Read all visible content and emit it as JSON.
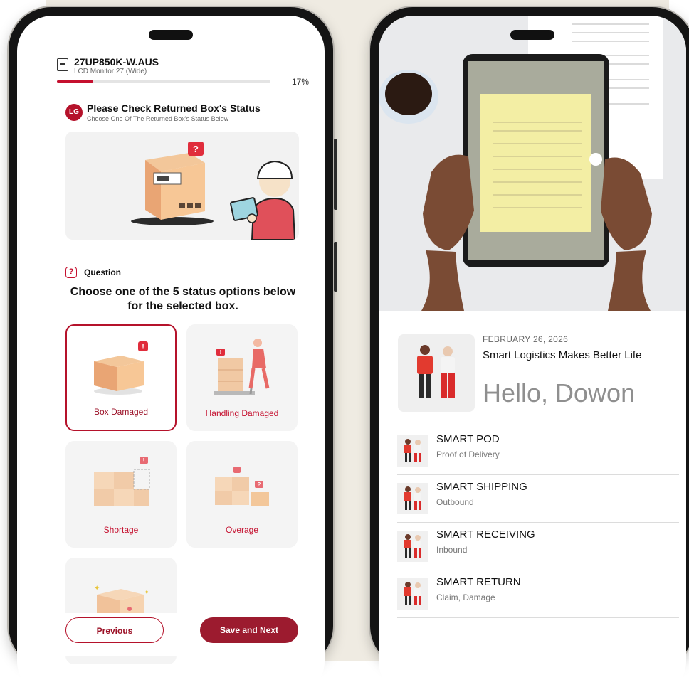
{
  "left_phone": {
    "product": {
      "model": "27UP850K-W.AUS",
      "description": "LCD Monitor 27 (Wide)"
    },
    "progress": {
      "percent": 17,
      "label": "17%"
    },
    "brand_logo": "LG",
    "section": {
      "title": "Please Check Returned Box's Status",
      "subtitle": "Choose One Of The Returned Box's Status Below"
    },
    "question": {
      "icon_label": "?",
      "label": "Question",
      "text": "Choose one of the 5 status options below for the selected box."
    },
    "options": [
      {
        "label": "Box Damaged",
        "selected": true
      },
      {
        "label": "Handling Damaged",
        "selected": false
      },
      {
        "label": "Shortage",
        "selected": false
      },
      {
        "label": "Overage",
        "selected": false
      },
      {
        "label": "",
        "selected": false
      }
    ],
    "buttons": {
      "previous": "Previous",
      "next": "Save and Next"
    }
  },
  "right_phone": {
    "date": "FEBRUARY 26, 2026",
    "tagline": "Smart Logistics Makes Better Life",
    "greeting": "Hello, Dowon",
    "menu": [
      {
        "title": "SMART POD",
        "subtitle": "Proof of Delivery"
      },
      {
        "title": "SMART SHIPPING",
        "subtitle": "Outbound"
      },
      {
        "title": "SMART RECEIVING",
        "subtitle": "Inbound"
      },
      {
        "title": "SMART RETURN",
        "subtitle": "Claim, Damage"
      }
    ]
  },
  "colors": {
    "accent": "#c5102f",
    "button_dark": "#9c1b2f",
    "background": "#efebe2"
  }
}
